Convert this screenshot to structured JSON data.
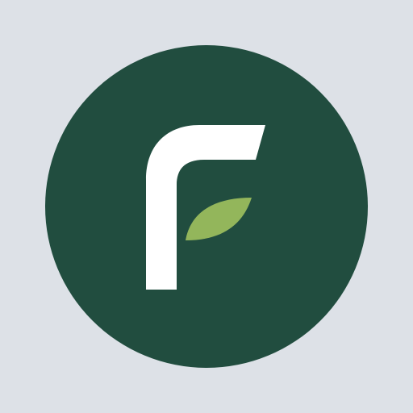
{
  "app": {
    "icon": "leaf-letter-f-logo"
  },
  "colors": {
    "background": "#dde1e7",
    "circle": "#214d3f",
    "letter": "#ffffff",
    "leaf": "#93b65b"
  }
}
